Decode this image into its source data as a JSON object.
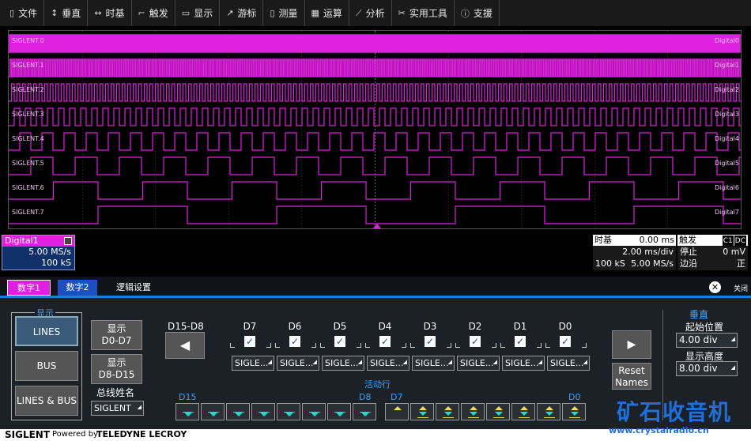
{
  "menu": [
    {
      "icon": "file-icon",
      "glyph": "▯",
      "label": "文件"
    },
    {
      "icon": "vertical-icon",
      "glyph": "↕",
      "label": "垂直"
    },
    {
      "icon": "timebase-icon",
      "glyph": "↔",
      "label": "时基"
    },
    {
      "icon": "trigger-icon",
      "glyph": "⌐",
      "label": "触发"
    },
    {
      "icon": "display-icon",
      "glyph": "▭",
      "label": "显示"
    },
    {
      "icon": "cursor-icon",
      "glyph": "↗",
      "label": "游标"
    },
    {
      "icon": "measure-icon",
      "glyph": "▯",
      "label": "测量"
    },
    {
      "icon": "math-icon",
      "glyph": "▦",
      "label": "运算"
    },
    {
      "icon": "analyze-icon",
      "glyph": "⟋",
      "label": "分析"
    },
    {
      "icon": "tools-icon",
      "glyph": "✂",
      "label": "实用工具"
    },
    {
      "icon": "support-icon",
      "glyph": "ⓘ",
      "label": "支援"
    }
  ],
  "channels": [
    "SIGLENT.0",
    "SIGLENT.1",
    "SIGLENT.2",
    "SIGLENT.3",
    "SIGLENT.4",
    "SIGLENT.5",
    "SIGLENT.6",
    "SIGLENT.7"
  ],
  "channels_right": [
    "Digital0",
    "Digital1",
    "Digital2",
    "Digital3",
    "Digital4",
    "Digital5",
    "Digital6",
    "Digital7"
  ],
  "colors": {
    "wave": "#e020e0",
    "accent": "#2a7acc",
    "tab_active": "#e020e0",
    "tab2": "#1a50c0",
    "cyan": "#1ae0d0",
    "yellow": "#f0e040"
  },
  "digital_box": {
    "title": "Digital1",
    "rate": "5.00 MS/s",
    "pts": "100 kS"
  },
  "timebase": {
    "label": "时基",
    "offset": "0.00 ms",
    "scale": "2.00 ms/div",
    "pts": "100 kS",
    "rate": "5.00 MS/s"
  },
  "trigger": {
    "label": "触发",
    "src": "C1",
    "cpl": "DC",
    "mode": "停止",
    "level": "0 mV",
    "type": "边沿",
    "slope": "正"
  },
  "tabs": {
    "t1": "数字1",
    "t2": "数字2",
    "t3": "逻辑设置",
    "close": "关闭"
  },
  "display_group": {
    "title": "显示",
    "lines": "LINES",
    "bus": "BUS",
    "lines_bus": "LINES & BUS"
  },
  "show_buttons": {
    "low_1": "显示",
    "low_2": "D0-D7",
    "high_1": "显示",
    "high_2": "D8-D15"
  },
  "bus_name": {
    "label": "总线姓名",
    "value": "SIGLENT"
  },
  "range_label": "D15-D8",
  "bits": [
    {
      "label": "D7",
      "name": "SIGLE..."
    },
    {
      "label": "D6",
      "name": "SIGLE..."
    },
    {
      "label": "D5",
      "name": "SIGLE..."
    },
    {
      "label": "D4",
      "name": "SIGLE..."
    },
    {
      "label": "D3",
      "name": "SIGLE..."
    },
    {
      "label": "D2",
      "name": "SIGLE..."
    },
    {
      "label": "D1",
      "name": "SIGLE..."
    },
    {
      "label": "D0",
      "name": "SIGLE..."
    }
  ],
  "active_row": {
    "label": "活动行",
    "d15": "D15",
    "d8": "D8",
    "d7": "D7",
    "d0": "D0"
  },
  "reset": {
    "l1": "Reset",
    "l2": "Names"
  },
  "vertical": {
    "title": "垂直",
    "pos_label": "起始位置",
    "pos": "4.00 div",
    "height_label": "显示高度",
    "height": "8.00 div"
  },
  "footer": {
    "brand": "SIGLENT",
    "powered": "Powered by",
    "teledyne": "TELEDYNE LECROY"
  },
  "watermark": {
    "text": "矿石收音机",
    "url": "www.crystalradio.cn"
  }
}
